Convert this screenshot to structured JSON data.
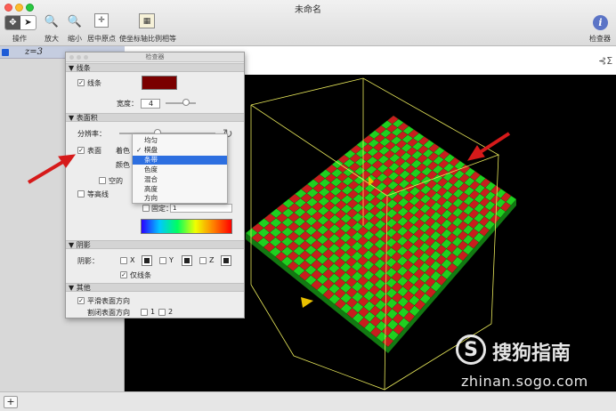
{
  "window": {
    "title": "未命名"
  },
  "toolbar": {
    "operate_label": "操作",
    "zoom_in_label": "放大",
    "zoom_out_label": "缩小",
    "center_origin_label": "居中原点",
    "equal_axes_label": "使坐标轴比例相等",
    "inspector_label": "检查器"
  },
  "sidebar": {
    "equation": "z=3"
  },
  "inspector": {
    "title": "检查器",
    "lines_section": "线条",
    "lines_checkbox": "线条",
    "lines_color": "#7a0000",
    "width_label": "宽度：",
    "width_value": "4",
    "surface_section": "表面积",
    "resolution_label": "分辨率：",
    "surface_checkbox": "表面",
    "shading_label": "着色",
    "color_label": "颜色",
    "hollow_label": "空的",
    "contour_label": "等高线",
    "fixed_label": "固定：",
    "fixed_value": "1",
    "shadow_section": "阴影",
    "shadow_label": "阴影：",
    "axis_x": "X",
    "axis_y": "Y",
    "axis_z": "Z",
    "lines_only_label": "仅线条",
    "other_section": "其他",
    "smooth_label": "平滑表面方向",
    "cut_label": "割闭表面方向",
    "cut_1": "1",
    "cut_2": "2"
  },
  "dropdown": {
    "items": [
      "均匀",
      "棋盘",
      "条带",
      "色度",
      "混合",
      "高度",
      "方向"
    ],
    "checked": "棋盘",
    "highlighted": "条带"
  },
  "watermark": {
    "brand": "搜狗指南",
    "url": "zhinan.sogo.com"
  },
  "colors": {
    "grid_green": "#1fd01f",
    "grid_red": "#c81e1e",
    "box_yellow": "#e8e85a",
    "arrow_red": "#d61a1a"
  },
  "icons": [
    "pointer-icon",
    "zoom-in-icon",
    "zoom-out-icon",
    "center-origin-icon",
    "equal-axes-icon",
    "inspector-icon",
    "sigma-icon",
    "refresh-icon",
    "add-icon"
  ]
}
